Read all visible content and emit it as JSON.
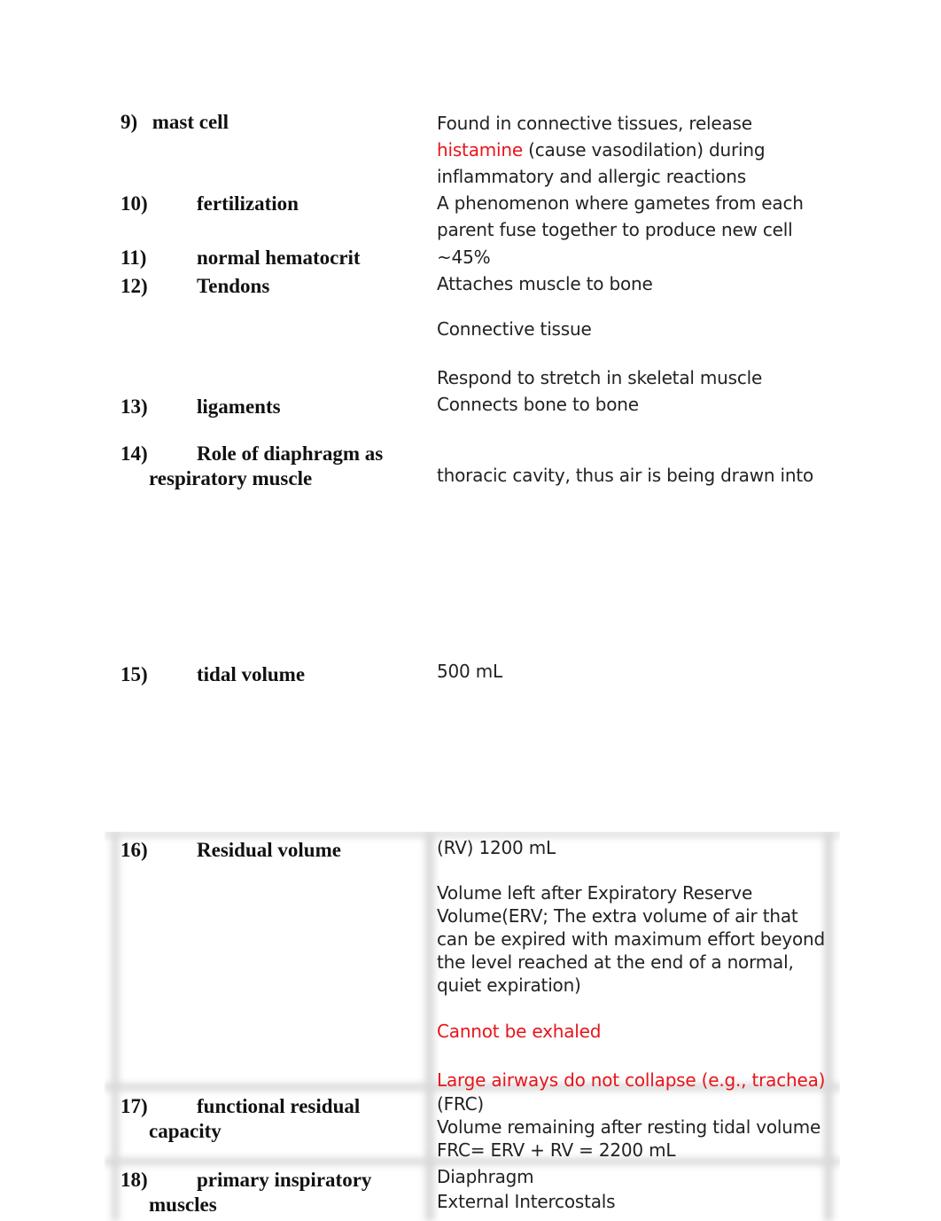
{
  "entries": [
    {
      "num": "9)",
      "term": "mast cell",
      "def_lines": [
        {
          "parts": [
            {
              "text": "Found in connective tissues, release",
              "red": false
            }
          ]
        },
        {
          "parts": [
            {
              "text": "histamine",
              "red": true
            },
            {
              "text": " (cause vasodilation) during",
              "red": false
            }
          ]
        },
        {
          "parts": [
            {
              "text": "inflammatory and allergic reactions",
              "red": false
            }
          ]
        }
      ]
    },
    {
      "num": "10)",
      "term": "fertilization",
      "def_lines": [
        "A phenomenon where gametes from each",
        "parent fuse together to produce new cell"
      ]
    },
    {
      "num": "11)",
      "term": "normal hematocrit",
      "def_lines": [
        "~45%"
      ]
    },
    {
      "num": "12)",
      "term": "Tendons",
      "def_lines": [
        "Attaches muscle to bone",
        "Connective tissue",
        "Respond to stretch in skeletal muscle"
      ]
    },
    {
      "num": "13)",
      "term": "ligaments",
      "def_lines": [
        "Connects bone to bone"
      ]
    },
    {
      "num": "14)",
      "term": "Role of diaphragm as",
      "term_cont": "respiratory muscle",
      "def_lines": [
        "thoracic cavity, thus air is being drawn into"
      ]
    },
    {
      "num": "15)",
      "term": "tidal volume",
      "def_lines": [
        "500 mL"
      ]
    },
    {
      "num": "16)",
      "term": "Residual volume",
      "def_lines": [
        "(RV) 1200 mL",
        "Volume left after Expiratory Reserve",
        "Volume(ERV; The extra volume of air that",
        "can be expired with maximum effort beyond",
        "the level reached at the end of a normal,",
        "quiet expiration)",
        "Cannot be exhaled",
        "Large airways do not collapse (e.g., trachea)"
      ]
    },
    {
      "num": "17)",
      "term": "functional residual",
      "term_cont": "capacity",
      "def_lines": [
        "(FRC)",
        "Volume remaining after resting tidal volume",
        "FRC= ERV + RV = 2200 mL"
      ]
    },
    {
      "num": "18)",
      "term": "primary inspiratory",
      "term_cont": "muscles",
      "def_lines": [
        "Diaphragm",
        "External Intercostals"
      ]
    }
  ],
  "colors": {
    "highlight": "#e8141a",
    "text": "#222222"
  }
}
